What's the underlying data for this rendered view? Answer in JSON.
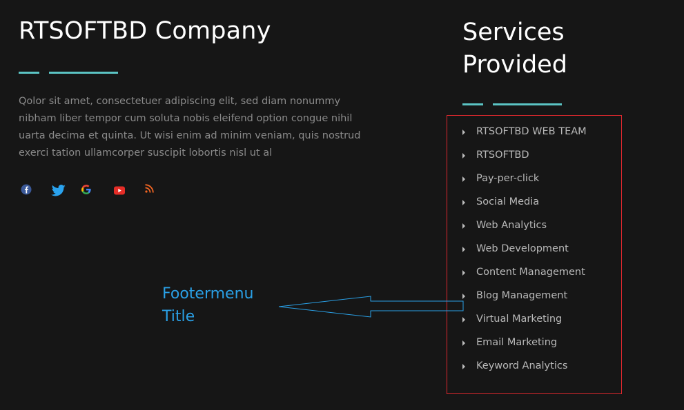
{
  "company": {
    "title": "RTSOFTBD Company",
    "description": "Qolor sit amet, consectetuer adipiscing elit, sed diam nonummy nibham liber tempor cum soluta nobis eleifend option congue nihil uarta decima et quinta. Ut wisi enim ad minim veniam, quis nostrud exerci tation ullamcorper suscipit lobortis nisl ut al",
    "social_icons": [
      "facebook-icon",
      "twitter-icon",
      "google-icon",
      "youtube-icon",
      "rss-icon"
    ]
  },
  "services": {
    "title": "Services Provided",
    "items": [
      {
        "label": "RTSOFTBD WEB TEAM"
      },
      {
        "label": "RTSOFTBD"
      },
      {
        "label": "Pay-per-click"
      },
      {
        "label": "Social Media"
      },
      {
        "label": "Web Analytics"
      },
      {
        "label": "Web Development"
      },
      {
        "label": "Content Management"
      },
      {
        "label": "Blog Management"
      },
      {
        "label": "Virtual Marketing"
      },
      {
        "label": "Email Marketing"
      },
      {
        "label": "Keyword Analytics"
      }
    ]
  },
  "annotation": {
    "label": "Footermenu Title"
  },
  "colors": {
    "background": "#161616",
    "accent_line": "#5bc4c4",
    "highlight_box": "#e0282e",
    "annotation": "#2aa0e6"
  }
}
